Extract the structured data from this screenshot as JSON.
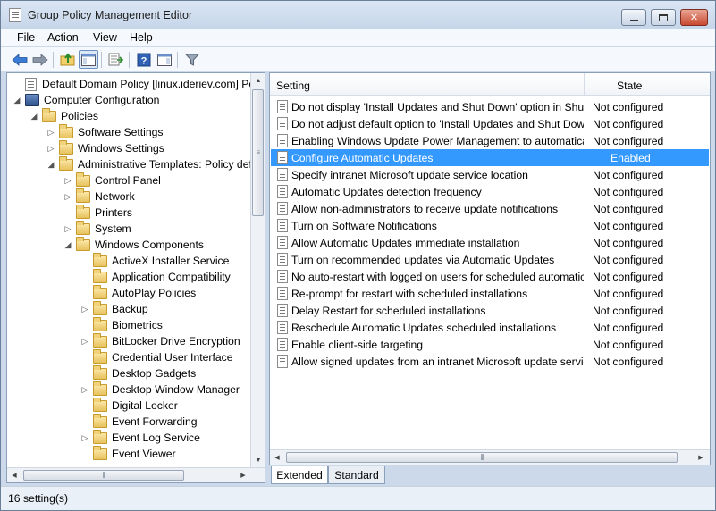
{
  "window": {
    "title": "Group Policy Management Editor"
  },
  "menu": [
    "File",
    "Action",
    "View",
    "Help"
  ],
  "tree": [
    {
      "label": "Default Domain Policy [linux.ideriev.com] Policy",
      "icon": "doc",
      "level": 0,
      "expander": ""
    },
    {
      "label": "Computer Configuration",
      "icon": "computer",
      "level": 0,
      "expander": "open"
    },
    {
      "label": "Policies",
      "icon": "folder",
      "level": 1,
      "expander": "open"
    },
    {
      "label": "Software Settings",
      "icon": "folder",
      "level": 2,
      "expander": "closed"
    },
    {
      "label": "Windows Settings",
      "icon": "folder",
      "level": 2,
      "expander": "closed"
    },
    {
      "label": "Administrative Templates: Policy definitions",
      "icon": "folder",
      "level": 2,
      "expander": "open"
    },
    {
      "label": "Control Panel",
      "icon": "folder",
      "level": 3,
      "expander": "closed"
    },
    {
      "label": "Network",
      "icon": "folder",
      "level": 3,
      "expander": "closed"
    },
    {
      "label": "Printers",
      "icon": "folder",
      "level": 3,
      "expander": ""
    },
    {
      "label": "System",
      "icon": "folder",
      "level": 3,
      "expander": "closed"
    },
    {
      "label": "Windows Components",
      "icon": "folder",
      "level": 3,
      "expander": "open"
    },
    {
      "label": "ActiveX Installer Service",
      "icon": "folder",
      "level": 4,
      "expander": ""
    },
    {
      "label": "Application Compatibility",
      "icon": "folder",
      "level": 4,
      "expander": ""
    },
    {
      "label": "AutoPlay Policies",
      "icon": "folder",
      "level": 4,
      "expander": ""
    },
    {
      "label": "Backup",
      "icon": "folder",
      "level": 4,
      "expander": "closed"
    },
    {
      "label": "Biometrics",
      "icon": "folder",
      "level": 4,
      "expander": ""
    },
    {
      "label": "BitLocker Drive Encryption",
      "icon": "folder",
      "level": 4,
      "expander": "closed"
    },
    {
      "label": "Credential User Interface",
      "icon": "folder",
      "level": 4,
      "expander": ""
    },
    {
      "label": "Desktop Gadgets",
      "icon": "folder",
      "level": 4,
      "expander": ""
    },
    {
      "label": "Desktop Window Manager",
      "icon": "folder",
      "level": 4,
      "expander": "closed"
    },
    {
      "label": "Digital Locker",
      "icon": "folder",
      "level": 4,
      "expander": ""
    },
    {
      "label": "Event Forwarding",
      "icon": "folder",
      "level": 4,
      "expander": ""
    },
    {
      "label": "Event Log Service",
      "icon": "folder",
      "level": 4,
      "expander": "closed"
    },
    {
      "label": "Event Viewer",
      "icon": "folder",
      "level": 4,
      "expander": ""
    }
  ],
  "list": {
    "headers": {
      "setting": "Setting",
      "state": "State"
    },
    "rows": [
      {
        "name": "Do not display 'Install Updates and Shut Down' option in Shut Down Windows dialog box",
        "state": "Not configured"
      },
      {
        "name": "Do not adjust default option to 'Install Updates and Shut Down' in Shut Down Windows dialog box",
        "state": "Not configured"
      },
      {
        "name": "Enabling Windows Update Power Management to automatically wake up the system",
        "state": "Not configured"
      },
      {
        "name": "Configure Automatic Updates",
        "state": "Enabled",
        "selected": true
      },
      {
        "name": "Specify intranet Microsoft update service location",
        "state": "Not configured"
      },
      {
        "name": "Automatic Updates detection frequency",
        "state": "Not configured"
      },
      {
        "name": "Allow non-administrators to receive update notifications",
        "state": "Not configured"
      },
      {
        "name": "Turn on Software Notifications",
        "state": "Not configured"
      },
      {
        "name": "Allow Automatic Updates immediate installation",
        "state": "Not configured"
      },
      {
        "name": "Turn on recommended updates via Automatic Updates",
        "state": "Not configured"
      },
      {
        "name": "No auto-restart with logged on users for scheduled automatic updates installations",
        "state": "Not configured"
      },
      {
        "name": "Re-prompt for restart with scheduled installations",
        "state": "Not configured"
      },
      {
        "name": "Delay Restart for scheduled installations",
        "state": "Not configured"
      },
      {
        "name": "Reschedule Automatic Updates scheduled installations",
        "state": "Not configured"
      },
      {
        "name": "Enable client-side targeting",
        "state": "Not configured"
      },
      {
        "name": "Allow signed updates from an intranet Microsoft update service location",
        "state": "Not configured"
      }
    ]
  },
  "tabs": [
    "Extended",
    "Standard"
  ],
  "status": "16 setting(s)"
}
